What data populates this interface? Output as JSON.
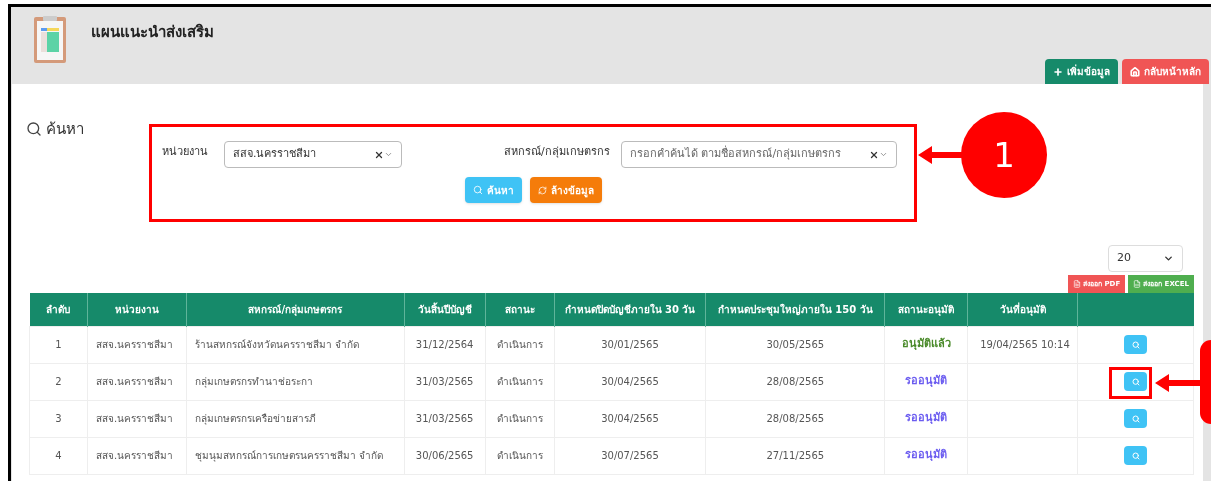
{
  "page": {
    "title": "แผนแนะนำส่งเสริม"
  },
  "header_buttons": [
    {
      "kind": "add",
      "label": "เพิ่มข้อมูล"
    },
    {
      "kind": "home",
      "label": "กลับหน้าหลัก"
    }
  ],
  "search": {
    "title": "ค้นหา",
    "fields": [
      {
        "label": "หน่วยงาน",
        "value": "สสจ.นครราชสีมา"
      },
      {
        "label": "สหกรณ์/กลุ่มเกษตรกร",
        "placeholder": "กรอกคำค้นได้ ตามชื่อสหกรณ์/กลุ่มเกษตรกร"
      }
    ],
    "buttons": [
      {
        "kind": "search",
        "label": "ค้นหา"
      },
      {
        "kind": "clear",
        "label": "ล้างข้อมูล"
      }
    ]
  },
  "page_size": "20",
  "export_buttons": [
    {
      "kind": "pdf",
      "label": "ส่งออก PDF"
    },
    {
      "kind": "excel",
      "label": "ส่งออก EXCEL"
    }
  ],
  "table": {
    "columns": [
      "ลำดับ",
      "หน่วยงาน",
      "สหกรณ์/กลุ่มเกษตรกร",
      "วันสิ้นปีบัญชี",
      "สถานะ",
      "กำหนดปิดบัญชีภายใน 30 วัน",
      "กำหนดประชุมใหญ่ภายใน 150 วัน",
      "สถานะอนุมัติ",
      "วันที่อนุมัติ"
    ],
    "rows": [
      {
        "no": "1",
        "agency": "สสจ.นครราชสีมา",
        "coop": "ร้านสหกรณ์จังหวัดนครราชสีมา จำกัด",
        "fiscal_end": "31/12/2564",
        "status": "ดำเนินการ",
        "close_by": "30/01/2565",
        "meeting_by": "30/05/2565",
        "approval": "อนุมัติแล้ว",
        "color": "#4a8a2a",
        "approved_at": "19/04/2565 10:14"
      },
      {
        "no": "2",
        "agency": "สสจ.นครราชสีมา",
        "coop": "กลุ่มเกษตรกรทำนาช่อระกา",
        "fiscal_end": "31/03/2565",
        "status": "ดำเนินการ",
        "close_by": "30/04/2565",
        "meeting_by": "28/08/2565",
        "approval": "รออนุมัติ",
        "color": "#6b5cf0"
      },
      {
        "no": "3",
        "agency": "สสจ.นครราชสีมา",
        "coop": "กลุ่มเกษตรกรเครือข่ายสารภี",
        "fiscal_end": "31/03/2565",
        "status": "ดำเนินการ",
        "close_by": "30/04/2565",
        "meeting_by": "28/08/2565",
        "approval": "รออนุมัติ",
        "color": "#6b5cf0"
      },
      {
        "no": "4",
        "agency": "สสจ.นครราชสีมา",
        "coop": "ชุมนุมสหกรณ์การเกษตรนครราชสีมา จำกัด",
        "fiscal_end": "30/06/2565",
        "status": "ดำเนินการ",
        "close_by": "30/07/2565",
        "meeting_by": "27/11/2565",
        "approval": "รออนุมัติ",
        "color": "#6b5cf0"
      }
    ]
  },
  "callouts": [
    {
      "kind": "search_panel",
      "label": "1"
    },
    {
      "kind": "row_button"
    }
  ]
}
